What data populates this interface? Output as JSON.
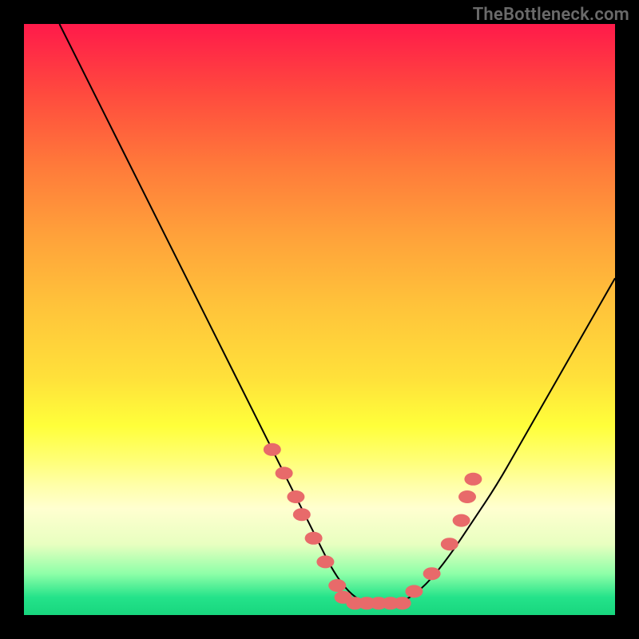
{
  "attribution": "TheBottleneck.com",
  "colors": {
    "frame_bg_top": "#ff1a4a",
    "frame_bg_bottom": "#18d67e",
    "curve": "#000000",
    "marker": "#e86a6a",
    "page_bg": "#000000"
  },
  "chart_data": {
    "type": "line",
    "title": "",
    "xlabel": "",
    "ylabel": "",
    "xlim": [
      0,
      100
    ],
    "ylim": [
      0,
      100
    ],
    "grid": false,
    "legend": null,
    "series": [
      {
        "name": "curve",
        "x": [
          6,
          10,
          14,
          18,
          22,
          26,
          30,
          34,
          38,
          42,
          46,
          50,
          52,
          54,
          56,
          58,
          60,
          64,
          68,
          72,
          76,
          80,
          84,
          88,
          92,
          96,
          100
        ],
        "values": [
          100,
          92,
          84,
          76,
          68,
          60,
          52,
          44,
          36,
          28,
          20,
          12,
          8,
          5,
          3,
          2,
          2,
          2,
          5,
          10,
          16,
          22,
          29,
          36,
          43,
          50,
          57
        ]
      }
    ],
    "markers": [
      {
        "x": 42,
        "y": 28
      },
      {
        "x": 44,
        "y": 24
      },
      {
        "x": 46,
        "y": 20
      },
      {
        "x": 47,
        "y": 17
      },
      {
        "x": 49,
        "y": 13
      },
      {
        "x": 51,
        "y": 9
      },
      {
        "x": 53,
        "y": 5
      },
      {
        "x": 54,
        "y": 3
      },
      {
        "x": 56,
        "y": 2
      },
      {
        "x": 58,
        "y": 2
      },
      {
        "x": 60,
        "y": 2
      },
      {
        "x": 62,
        "y": 2
      },
      {
        "x": 64,
        "y": 2
      },
      {
        "x": 66,
        "y": 4
      },
      {
        "x": 69,
        "y": 7
      },
      {
        "x": 72,
        "y": 12
      },
      {
        "x": 74,
        "y": 16
      },
      {
        "x": 75,
        "y": 20
      },
      {
        "x": 76,
        "y": 23
      }
    ]
  }
}
